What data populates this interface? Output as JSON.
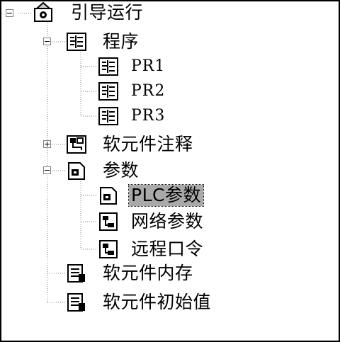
{
  "tree": {
    "root": {
      "label": "引导运行",
      "icon": "root-project-icon",
      "expanded": true
    },
    "nodes": [
      {
        "id": "program",
        "label": "程序",
        "icon": "program-icon",
        "expanded": true
      },
      {
        "id": "pr1",
        "label": "PR1",
        "icon": "program-file-icon"
      },
      {
        "id": "pr2",
        "label": "PR2",
        "icon": "program-file-icon"
      },
      {
        "id": "pr3",
        "label": "PR3",
        "icon": "program-file-icon"
      },
      {
        "id": "device-comment",
        "label": "软元件注释",
        "icon": "device-comment-icon",
        "expanded": false
      },
      {
        "id": "parameter",
        "label": "参数",
        "icon": "parameter-icon",
        "expanded": true
      },
      {
        "id": "plc-param",
        "label": "PLC参数",
        "icon": "plc-parameter-icon",
        "selected": true
      },
      {
        "id": "network-param",
        "label": "网络参数",
        "icon": "network-parameter-icon"
      },
      {
        "id": "remote-password",
        "label": "远程口令",
        "icon": "remote-password-icon"
      },
      {
        "id": "device-memory",
        "label": "软元件内存",
        "icon": "device-memory-icon"
      },
      {
        "id": "device-init",
        "label": "软元件初始值",
        "icon": "device-init-icon"
      }
    ]
  }
}
